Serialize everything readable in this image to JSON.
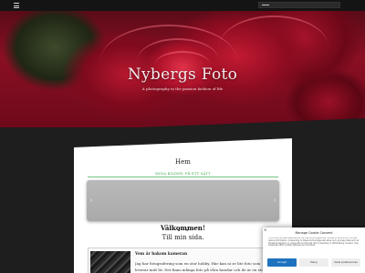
{
  "header": {
    "menu_icon": "hamburger-menu-icon"
  },
  "hero": {
    "title": "Nybergs Foto",
    "tagline": "A photography in the passion fashion of life"
  },
  "content": {
    "page_title": "Hem",
    "green_link": "MINA BILDER, PÅ ETT SÄTT",
    "slider": {
      "prev_label": "‹",
      "next_label": "›",
      "dot_count": 2,
      "active_dot": 1
    },
    "welcome_heading": "Välkommen!",
    "welcome_sub": "Till min sida.",
    "card": {
      "title": "Vem är bakom kameran",
      "text": "Jag har fotografering som en stor hobby. Här kan ni se lite foto som leverar mitt liv. Det finns många foto på våra hundar och de är en stor del av mitt liv."
    }
  },
  "cookie": {
    "close_label": "✕",
    "title": "Manage Cookie Consent",
    "body": "To provide the best experiences, we use technologies like cookies to store and/or access device information. Consenting to these technologies will allow us to process data such as browsing behavior or unique IDs on this site. Not consenting or withdrawing consent, may adversely affect certain features and functions.",
    "accept_label": "Accept",
    "deny_label": "Deny",
    "prefs_label": "View preferences",
    "accent_color": "#1e73be"
  }
}
